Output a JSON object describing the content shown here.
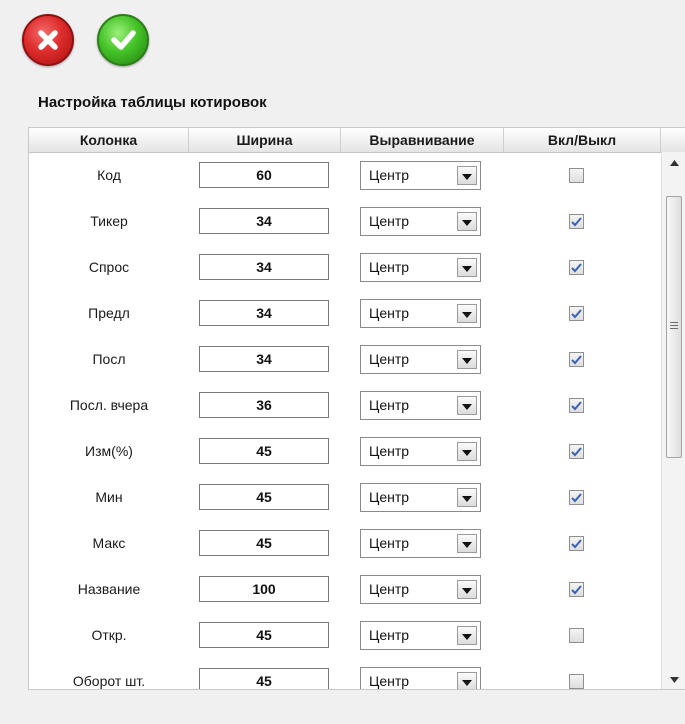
{
  "toolbar": {
    "cancel_icon": "close-icon",
    "confirm_icon": "check-icon"
  },
  "panel": {
    "title": "Настройка таблицы котировок"
  },
  "table": {
    "columns": [
      "Колонка",
      "Ширина",
      "Выравнивание",
      "Вкл/Выкл"
    ],
    "rows": [
      {
        "name": "Код",
        "width": "60",
        "align": "Центр",
        "enabled": false
      },
      {
        "name": "Тикер",
        "width": "34",
        "align": "Центр",
        "enabled": true
      },
      {
        "name": "Спрос",
        "width": "34",
        "align": "Центр",
        "enabled": true
      },
      {
        "name": "Предл",
        "width": "34",
        "align": "Центр",
        "enabled": true
      },
      {
        "name": "Посл",
        "width": "34",
        "align": "Центр",
        "enabled": true
      },
      {
        "name": "Посл. вчера",
        "width": "36",
        "align": "Центр",
        "enabled": true
      },
      {
        "name": "Изм(%)",
        "width": "45",
        "align": "Центр",
        "enabled": true
      },
      {
        "name": "Мин",
        "width": "45",
        "align": "Центр",
        "enabled": true
      },
      {
        "name": "Макс",
        "width": "45",
        "align": "Центр",
        "enabled": true
      },
      {
        "name": "Название",
        "width": "100",
        "align": "Центр",
        "enabled": true
      },
      {
        "name": "Откр.",
        "width": "45",
        "align": "Центр",
        "enabled": false
      },
      {
        "name": "Оборот шт.",
        "width": "45",
        "align": "Центр",
        "enabled": false
      }
    ]
  },
  "colors": {
    "cancel": "#dd2c2c",
    "confirm": "#44c327",
    "check": "#3a62b0"
  }
}
